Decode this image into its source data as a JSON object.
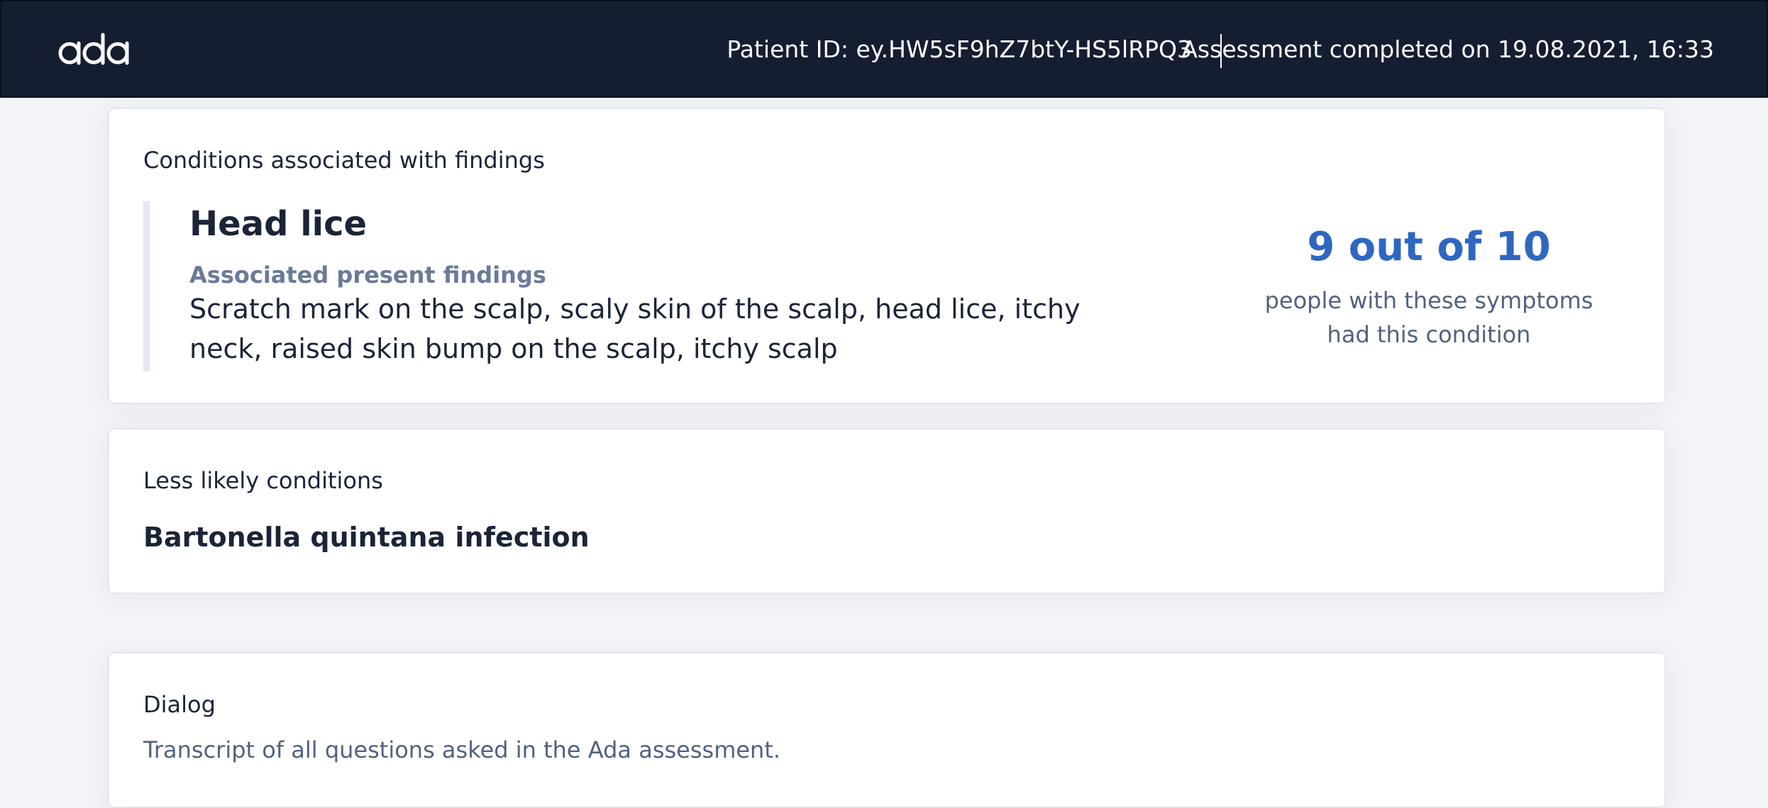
{
  "header": {
    "logo": "ada",
    "patient_id": "Patient ID: ey.HW5sF9hZ7btY-HS5lRPQ3",
    "assessment": "Assessment completed on 19.08.2021, 16:33"
  },
  "conditions_card": {
    "title": "Conditions associated with findings",
    "condition": {
      "name": "Head lice",
      "findings_label": "Associated present findings",
      "findings": "Scratch mark on the scalp, scaly skin of the scalp, head lice, itchy neck, raised skin bump on the scalp, itchy scalp"
    },
    "stat": {
      "value": "9 out of 10",
      "caption_line1": "people with these symptoms",
      "caption_line2": "had this condition"
    }
  },
  "less_likely_card": {
    "title": "Less likely conditions",
    "condition_name": "Bartonella quintana infection"
  },
  "dialog_card": {
    "title": "Dialog",
    "subtitle": "Transcript of all questions asked in the Ada assessment."
  },
  "colors": {
    "header_bg": "#151d31",
    "accent": "#2e67c1",
    "muted_label": "#6b7a99",
    "page_bg": "#f2f4f7"
  }
}
